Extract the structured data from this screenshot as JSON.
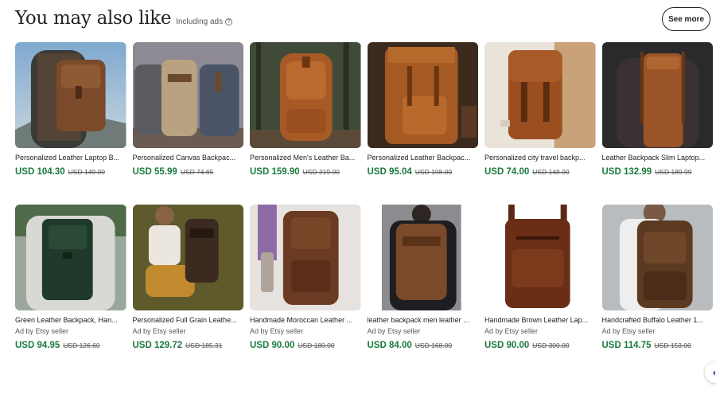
{
  "header": {
    "title": "You may also like",
    "subtitle": "Including ads",
    "info_icon": "question-circle-icon",
    "see_more_label": "See more"
  },
  "colors": {
    "price_green": "#1b7a3e",
    "text": "#222222",
    "muted": "#595959"
  },
  "listings": [
    [
      {
        "title": "Personalized Leather Laptop B...",
        "ad": "",
        "price": "USD 104.30",
        "original": "USD 149.00",
        "thumb": "man-hiking-brown-leather-backpack"
      },
      {
        "title": "Personalized Canvas Backpac...",
        "ad": "",
        "price": "USD 55.99",
        "original": "USD 74.65",
        "thumb": "three-canvas-backpacks"
      },
      {
        "title": "Personalized Men's Leather Ba...",
        "ad": "",
        "price": "USD 159.90",
        "original": "USD 319.00",
        "thumb": "tan-leather-backpack-forest"
      },
      {
        "title": "Personalized Leather Backpac...",
        "ad": "",
        "price": "USD 95.04",
        "original": "USD 198.00",
        "thumb": "tan-roll-top-backpack"
      },
      {
        "title": "Personalized city travel backp...",
        "ad": "",
        "price": "USD 74.00",
        "original": "USD 148.00",
        "thumb": "tan-backpack-beige-backdrop"
      },
      {
        "title": "Leather Backpack Slim Laptop...",
        "ad": "",
        "price": "USD 132.99",
        "original": "USD 189.99",
        "thumb": "man-slim-brown-backpack"
      }
    ],
    [
      {
        "title": "Green Leather Backpack, Han...",
        "ad": "Ad by Etsy seller",
        "price": "USD 94.95",
        "original": "USD 126.60",
        "thumb": "green-leather-backpack-worn"
      },
      {
        "title": "Personalized Full Grain Leathe...",
        "ad": "Ad by Etsy seller",
        "price": "USD 129.72",
        "original": "USD 185.31",
        "thumb": "seated-man-dark-backpack"
      },
      {
        "title": "Handmade Moroccan Leather ...",
        "ad": "Ad by Etsy seller",
        "price": "USD 90.00",
        "original": "USD 180.00",
        "thumb": "moroccan-backpack-with-flowers"
      },
      {
        "title": "leather backpack men leather ...",
        "ad": "Ad by Etsy seller",
        "price": "USD 84.00",
        "original": "USD 168.00",
        "thumb": "man-back-distressed-backpack"
      },
      {
        "title": "Handmade Brown Leather Lap...",
        "ad": "Ad by Etsy seller",
        "price": "USD 90.00",
        "original": "USD 300.00",
        "thumb": "brown-backpack-white-bg"
      },
      {
        "title": "Handcrafted Buffalo Leather 1...",
        "ad": "Ad by Etsy seller",
        "price": "USD 114.75",
        "original": "USD 153.00",
        "thumb": "man-buffalo-leather-backpack"
      }
    ]
  ],
  "floating_button_icon": "chat-icon"
}
